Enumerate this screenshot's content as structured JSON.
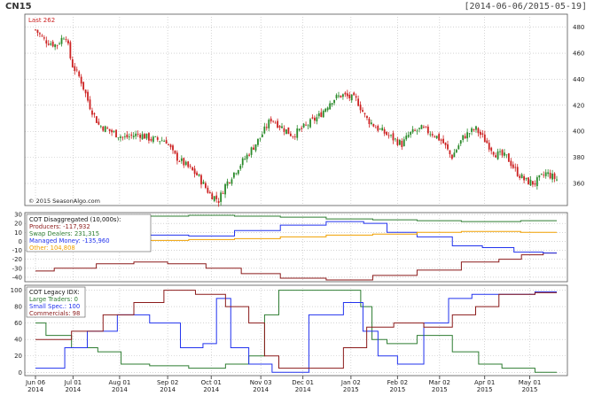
{
  "header": {
    "symbol": "CN15",
    "date_range": "[2014-06-06/2015-05-19]"
  },
  "colors": {
    "up": "#2a8a2a",
    "down": "#cc2222",
    "grid": "#bbbbbb",
    "producers": "#8b1a1a",
    "swap": "#2e7d32",
    "managed": "#2233ee",
    "other": "#f0a000",
    "large": "#2e7d32",
    "small": "#2233ee",
    "commercials": "#8b1a1a"
  },
  "chart_data": [
    {
      "type": "candlestick",
      "last_label": "Last 262",
      "copyright": "© 2015 SeasonAlgo.com",
      "ylim": [
        343,
        490
      ],
      "yticks": [
        360,
        380,
        400,
        420,
        440,
        460,
        480
      ],
      "x_dates": [
        "2014-06-06",
        "2015-05-19"
      ],
      "trend": [
        [
          "2014-06-06",
          478
        ],
        [
          "2014-06-12",
          470
        ],
        [
          "2014-06-20",
          466
        ],
        [
          "2014-06-26",
          475
        ],
        [
          "2014-06-30",
          452
        ],
        [
          "2014-07-06",
          440
        ],
        [
          "2014-07-12",
          420
        ],
        [
          "2014-07-18",
          405
        ],
        [
          "2014-07-26",
          400
        ],
        [
          "2014-08-04",
          395
        ],
        [
          "2014-08-14",
          398
        ],
        [
          "2014-08-22",
          394
        ],
        [
          "2014-09-01",
          393
        ],
        [
          "2014-09-06",
          382
        ],
        [
          "2014-09-14",
          374
        ],
        [
          "2014-09-22",
          366
        ],
        [
          "2014-09-30",
          352
        ],
        [
          "2014-10-06",
          347
        ],
        [
          "2014-10-10",
          358
        ],
        [
          "2014-10-16",
          368
        ],
        [
          "2014-10-24",
          380
        ],
        [
          "2014-11-03",
          396
        ],
        [
          "2014-11-10",
          410
        ],
        [
          "2014-11-16",
          404
        ],
        [
          "2014-11-24",
          397
        ],
        [
          "2014-12-03",
          404
        ],
        [
          "2014-12-12",
          412
        ],
        [
          "2014-12-20",
          424
        ],
        [
          "2014-12-27",
          428
        ],
        [
          "2015-01-06",
          424
        ],
        [
          "2015-01-12",
          410
        ],
        [
          "2015-01-20",
          402
        ],
        [
          "2015-01-28",
          396
        ],
        [
          "2015-02-05",
          390
        ],
        [
          "2015-02-10",
          398
        ],
        [
          "2015-02-18",
          402
        ],
        [
          "2015-02-26",
          398
        ],
        [
          "2015-03-04",
          392
        ],
        [
          "2015-03-10",
          380
        ],
        [
          "2015-03-18",
          396
        ],
        [
          "2015-03-26",
          402
        ],
        [
          "2015-04-02",
          392
        ],
        [
          "2015-04-08",
          383
        ],
        [
          "2015-04-16",
          380
        ],
        [
          "2015-04-22",
          369
        ],
        [
          "2015-04-28",
          362
        ],
        [
          "2015-05-04",
          360
        ],
        [
          "2015-05-12",
          368
        ],
        [
          "2015-05-19",
          363
        ]
      ],
      "candle_count": 240
    },
    {
      "type": "line",
      "title": "COT Disaggregated (10,000s):",
      "ylim": [
        -45,
        32
      ],
      "yticks": [
        -40,
        -30,
        -20,
        -10,
        0,
        10,
        20,
        30
      ],
      "series": [
        {
          "name": "Producers",
          "last": "-117,932",
          "color_key": "producers",
          "points": [
            [
              "2014-06-06",
              -33
            ],
            [
              "2014-07-01",
              -30
            ],
            [
              "2014-08-01",
              -25
            ],
            [
              "2014-08-20",
              -23
            ],
            [
              "2014-09-15",
              -25
            ],
            [
              "2014-10-10",
              -30
            ],
            [
              "2014-11-01",
              -36
            ],
            [
              "2014-12-01",
              -41
            ],
            [
              "2015-01-01",
              -43
            ],
            [
              "2015-02-01",
              -38
            ],
            [
              "2015-03-01",
              -32
            ],
            [
              "2015-04-01",
              -23
            ],
            [
              "2015-04-20",
              -20
            ],
            [
              "2015-05-01",
              -15
            ],
            [
              "2015-05-19",
              -13
            ]
          ]
        },
        {
          "name": "Swap Dealers",
          "last": "231,315",
          "color_key": "swap",
          "points": [
            [
              "2014-06-06",
              27
            ],
            [
              "2014-07-15",
              27
            ],
            [
              "2014-09-01",
              28
            ],
            [
              "2014-10-01",
              29
            ],
            [
              "2014-11-01",
              28
            ],
            [
              "2014-12-01",
              27
            ],
            [
              "2015-01-01",
              25
            ],
            [
              "2015-02-01",
              24
            ],
            [
              "2015-03-01",
              23
            ],
            [
              "2015-04-01",
              22
            ],
            [
              "2015-05-19",
              23
            ]
          ]
        },
        {
          "name": "Managed Money",
          "last": "-135,960",
          "color_key": "managed",
          "points": [
            [
              "2014-06-06",
              8
            ],
            [
              "2014-07-01",
              7
            ],
            [
              "2014-08-01",
              6
            ],
            [
              "2014-09-01",
              7
            ],
            [
              "2014-10-01",
              6
            ],
            [
              "2014-11-01",
              12
            ],
            [
              "2014-12-01",
              18
            ],
            [
              "2015-01-01",
              22
            ],
            [
              "2015-01-20",
              20
            ],
            [
              "2015-02-01",
              10
            ],
            [
              "2015-03-01",
              5
            ],
            [
              "2015-03-20",
              -5
            ],
            [
              "2015-04-10",
              -7
            ],
            [
              "2015-05-01",
              -12
            ],
            [
              "2015-05-19",
              -13
            ]
          ]
        },
        {
          "name": "Other",
          "last": "104,808",
          "color_key": "other",
          "points": [
            [
              "2014-06-06",
              -5
            ],
            [
              "2014-07-01",
              -3
            ],
            [
              "2014-08-01",
              -1
            ],
            [
              "2014-09-01",
              1
            ],
            [
              "2014-10-01",
              2
            ],
            [
              "2014-11-01",
              3
            ],
            [
              "2014-12-01",
              5
            ],
            [
              "2015-01-01",
              7
            ],
            [
              "2015-02-01",
              8
            ],
            [
              "2015-03-01",
              10
            ],
            [
              "2015-04-01",
              11
            ],
            [
              "2015-05-19",
              10
            ]
          ]
        }
      ]
    },
    {
      "type": "line",
      "title": "COT Legacy IDX:",
      "ylim": [
        -4,
        106
      ],
      "yticks": [
        0,
        20,
        40,
        60,
        80,
        100
      ],
      "series": [
        {
          "name": "Large Traders",
          "last": "0",
          "color_key": "large",
          "points": [
            [
              "2014-06-06",
              60
            ],
            [
              "2014-06-20",
              45
            ],
            [
              "2014-07-10",
              30
            ],
            [
              "2014-07-25",
              25
            ],
            [
              "2014-08-10",
              10
            ],
            [
              "2014-09-01",
              8
            ],
            [
              "2014-10-01",
              5
            ],
            [
              "2014-10-20",
              10
            ],
            [
              "2014-11-01",
              20
            ],
            [
              "2014-11-10",
              70
            ],
            [
              "2014-11-20",
              100
            ],
            [
              "2015-01-05",
              100
            ],
            [
              "2015-01-12",
              80
            ],
            [
              "2015-01-20",
              40
            ],
            [
              "2015-02-01",
              35
            ],
            [
              "2015-03-01",
              45
            ],
            [
              "2015-03-20",
              25
            ],
            [
              "2015-04-05",
              10
            ],
            [
              "2015-04-20",
              5
            ],
            [
              "2015-05-19",
              0
            ]
          ]
        },
        {
          "name": "Small Spec.",
          "last": "100",
          "color_key": "small",
          "points": [
            [
              "2014-06-06",
              5
            ],
            [
              "2014-06-20",
              5
            ],
            [
              "2014-07-01",
              30
            ],
            [
              "2014-07-20",
              50
            ],
            [
              "2014-08-10",
              70
            ],
            [
              "2014-09-01",
              60
            ],
            [
              "2014-09-20",
              30
            ],
            [
              "2014-10-01",
              35
            ],
            [
              "2014-10-08",
              90
            ],
            [
              "2014-10-20",
              30
            ],
            [
              "2014-11-01",
              10
            ],
            [
              "2014-11-20",
              0
            ],
            [
              "2014-12-20",
              70
            ],
            [
              "2015-01-05",
              85
            ],
            [
              "2015-01-15",
              50
            ],
            [
              "2015-01-25",
              20
            ],
            [
              "2015-02-10",
              10
            ],
            [
              "2015-03-01",
              60
            ],
            [
              "2015-03-15",
              90
            ],
            [
              "2015-04-01",
              95
            ],
            [
              "2015-04-20",
              95
            ],
            [
              "2015-05-19",
              98
            ]
          ]
        },
        {
          "name": "Commercials",
          "last": "98",
          "color_key": "commercials",
          "points": [
            [
              "2014-06-06",
              40
            ],
            [
              "2014-06-20",
              40
            ],
            [
              "2014-07-10",
              50
            ],
            [
              "2014-08-01",
              70
            ],
            [
              "2014-08-20",
              85
            ],
            [
              "2014-09-10",
              100
            ],
            [
              "2014-10-01",
              95
            ],
            [
              "2014-10-20",
              80
            ],
            [
              "2014-11-01",
              60
            ],
            [
              "2014-11-10",
              20
            ],
            [
              "2014-11-20",
              5
            ],
            [
              "2014-12-20",
              5
            ],
            [
              "2015-01-05",
              30
            ],
            [
              "2015-01-20",
              55
            ],
            [
              "2015-02-10",
              60
            ],
            [
              "2015-03-01",
              55
            ],
            [
              "2015-03-20",
              70
            ],
            [
              "2015-04-01",
              80
            ],
            [
              "2015-04-20",
              95
            ],
            [
              "2015-05-19",
              97
            ]
          ]
        }
      ]
    }
  ],
  "x_axis": {
    "ticks": [
      {
        "date": "2014-06-06",
        "l1": "Jun 06",
        "l2": "2014"
      },
      {
        "date": "2014-07-01",
        "l1": "Jul 01",
        "l2": "2014"
      },
      {
        "date": "2014-08-01",
        "l1": "Aug 01",
        "l2": "2014"
      },
      {
        "date": "2014-09-02",
        "l1": "Sep 02",
        "l2": "2014"
      },
      {
        "date": "2014-10-01",
        "l1": "Oct 01",
        "l2": "2014"
      },
      {
        "date": "2014-11-03",
        "l1": "Nov 03",
        "l2": "2014"
      },
      {
        "date": "2014-12-01",
        "l1": "Dec 01",
        "l2": "2014"
      },
      {
        "date": "2015-01-02",
        "l1": "Jan 02",
        "l2": "2015"
      },
      {
        "date": "2015-02-02",
        "l1": "Feb 02",
        "l2": "2015"
      },
      {
        "date": "2015-03-02",
        "l1": "Mar 02",
        "l2": "2015"
      },
      {
        "date": "2015-04-01",
        "l1": "Apr 01",
        "l2": "2015"
      },
      {
        "date": "2015-05-01",
        "l1": "May 01",
        "l2": "2015"
      }
    ]
  }
}
